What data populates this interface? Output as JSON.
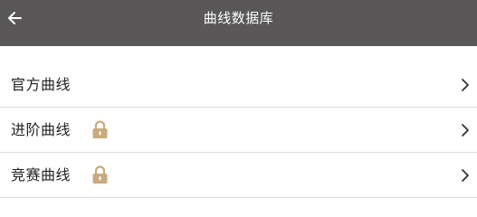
{
  "header": {
    "title": "曲线数据库",
    "back_icon": "arrow-left-icon",
    "background": "#595757"
  },
  "list": {
    "items": [
      {
        "label": "官方曲线",
        "locked": false
      },
      {
        "label": "进阶曲线",
        "locked": true
      },
      {
        "label": "竞赛曲线",
        "locked": true
      }
    ],
    "lock_color": "#c8aa7d",
    "chevron_icon": "chevron-right-icon",
    "lock_icon": "lock-icon"
  }
}
